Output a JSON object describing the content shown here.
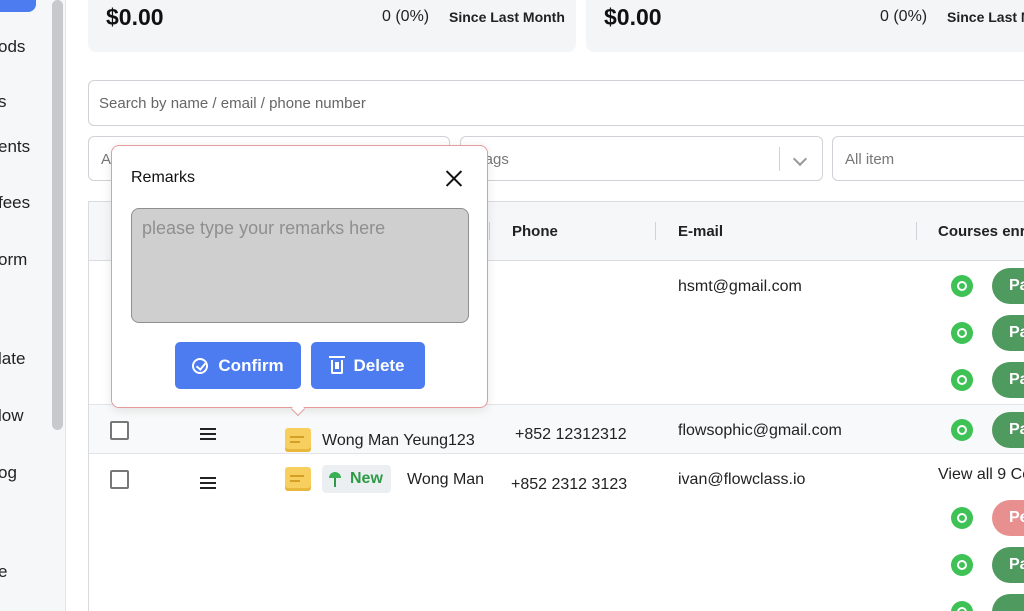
{
  "sidebar": {
    "items": [
      {
        "label": "ods"
      },
      {
        "label": "s"
      },
      {
        "label": "ents"
      },
      {
        "label": "fees"
      },
      {
        "label": "orm"
      },
      {
        "label": "late"
      },
      {
        "label": "low"
      },
      {
        "label": "og"
      },
      {
        "label": "e"
      }
    ]
  },
  "stats": [
    {
      "amount": "$0.00",
      "percent": "0 (0%)",
      "since": "Since Last Month"
    },
    {
      "amount": "$0.00",
      "percent": "0 (0%)",
      "since": "Since Last M"
    }
  ],
  "search": {
    "placeholder": "Search by name / email / phone number"
  },
  "filters": {
    "first": "A",
    "tags": "l tags",
    "items": "All item"
  },
  "table": {
    "headers": {
      "phone": "Phone",
      "email": "E-mail",
      "courses": "Courses enro"
    },
    "rows": [
      {
        "email": "hsmt@gmail.com",
        "pills": [
          "Pa",
          "Pa",
          "Pa"
        ]
      },
      {
        "name": "Wong Man Yeung123",
        "phone": "+852 12312312",
        "email": "flowsophic@gmail.com",
        "pills": [
          "Pa"
        ]
      },
      {
        "badge": "New",
        "name": "Wong Man",
        "phone": "+852 2312 3123",
        "email": "ivan@flowclass.io",
        "view_all": "View all 9 Co",
        "pills": [
          "Pe",
          "Pa"
        ]
      }
    ]
  },
  "popover": {
    "title": "Remarks",
    "placeholder": "please type your remarks here",
    "confirm_label": "Confirm",
    "delete_label": "Delete"
  },
  "colors": {
    "primary": "#4c7cf0",
    "paid": "#4f9a5f",
    "pending": "#e8908f",
    "whatsapp": "#3ec155"
  }
}
